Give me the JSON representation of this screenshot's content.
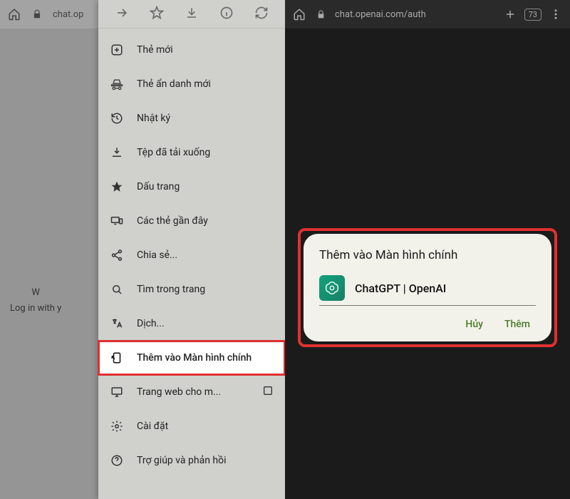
{
  "left": {
    "url": "chat.op",
    "background": {
      "welcome_char": "W",
      "login_text": "Log in with y"
    }
  },
  "menu": {
    "items": [
      {
        "label": "Thẻ mới",
        "icon": "plus-box"
      },
      {
        "label": "Thẻ ẩn danh mới",
        "icon": "incognito"
      },
      {
        "label": "Nhật ký",
        "icon": "history"
      },
      {
        "label": "Tệp đã tải xuống",
        "icon": "download-line"
      },
      {
        "label": "Dấu trang",
        "icon": "star"
      },
      {
        "label": "Các thẻ gần đây",
        "icon": "devices"
      },
      {
        "label": "Chia sẻ...",
        "icon": "share"
      },
      {
        "label": "Tìm trong trang",
        "icon": "search-page"
      },
      {
        "label": "Dịch...",
        "icon": "translate"
      },
      {
        "label": "Thêm vào Màn hình chính",
        "icon": "add-home",
        "highlight": true
      },
      {
        "label": "Trang web cho m...",
        "icon": "desktop",
        "checkbox": true
      },
      {
        "label": "Cài đặt",
        "icon": "gear"
      },
      {
        "label": "Trợ giúp và phản hồi",
        "icon": "help"
      }
    ]
  },
  "right": {
    "url": "chat.openai.com/auth",
    "tab_count": "73"
  },
  "dialog": {
    "title": "Thêm vào Màn hình chính",
    "app_name": "ChatGPT | OpenAI",
    "cancel": "Hủy",
    "confirm": "Thêm"
  },
  "colors": {
    "highlight": "#e03030",
    "dialog_accent": "#4a7a28"
  }
}
